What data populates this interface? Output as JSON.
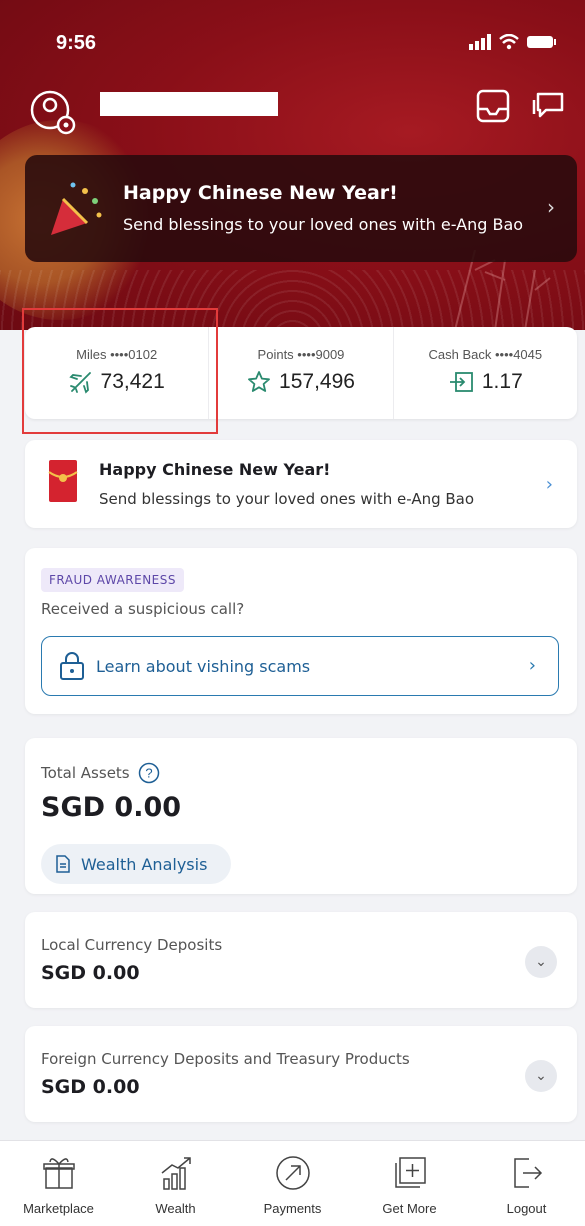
{
  "status": {
    "time": "9:56"
  },
  "header": {
    "promo_title": "Happy Chinese New Year!",
    "promo_sub": "Send blessings to your loved ones with e-Ang Bao"
  },
  "rewards": [
    {
      "label": "Miles ••••0102",
      "value": "73,421",
      "icon": "plane-icon"
    },
    {
      "label": "Points ••••9009",
      "value": "157,496",
      "icon": "star-icon"
    },
    {
      "label": "Cash Back ••••4045",
      "value": "1.17",
      "icon": "cashback-icon"
    }
  ],
  "promo2": {
    "title": "Happy Chinese New Year!",
    "sub": "Send blessings to your loved ones with e-Ang Bao"
  },
  "fraud": {
    "badge": "FRAUD AWARENESS",
    "question": "Received a suspicious call?",
    "link": "Learn about vishing scams"
  },
  "assets": {
    "label": "Total Assets",
    "amount": "SGD 0.00",
    "analysis": "Wealth Analysis"
  },
  "deposits": [
    {
      "label": "Local Currency Deposits",
      "amount": "SGD 0.00"
    },
    {
      "label": "Foreign Currency Deposits and Treasury Products",
      "amount": "SGD 0.00"
    }
  ],
  "nav": [
    "Marketplace",
    "Wealth",
    "Payments",
    "Get More",
    "Logout"
  ],
  "colors": {
    "hero": "#8a0f18",
    "accent": "#1e5f95",
    "highlight": "#e23b3b"
  }
}
